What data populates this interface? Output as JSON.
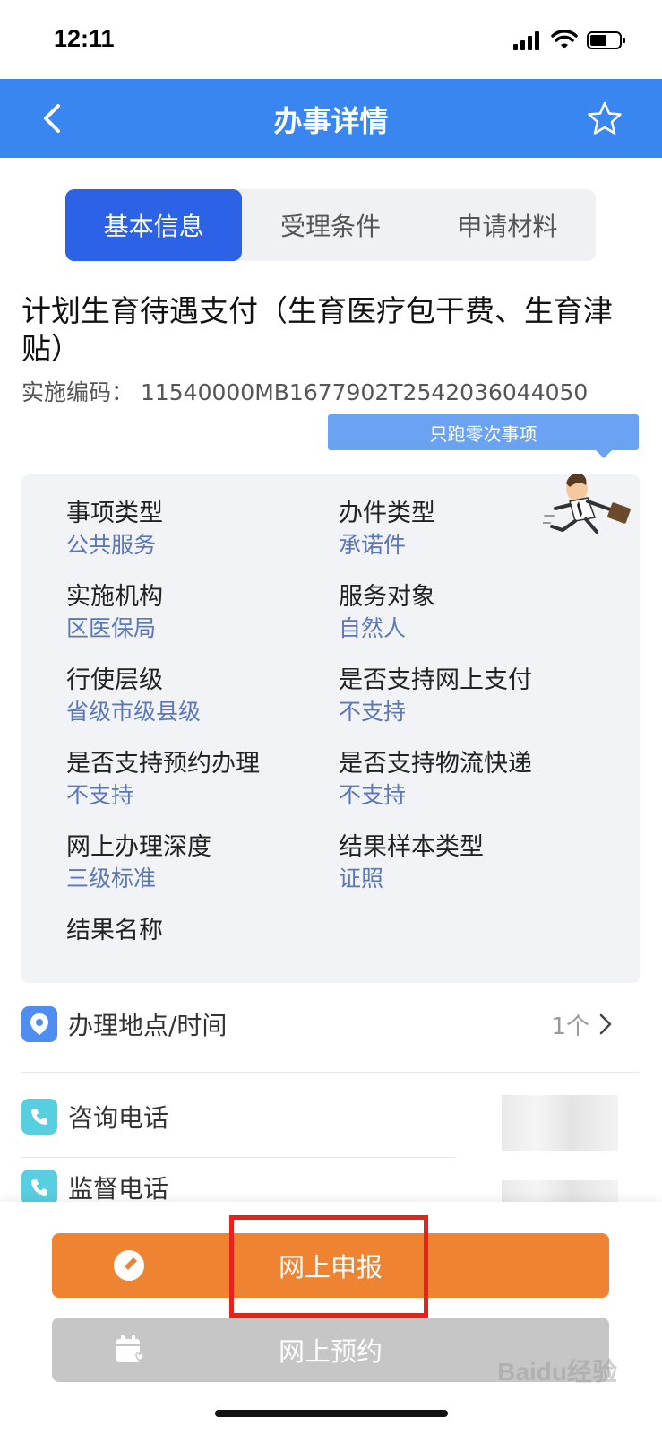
{
  "status": {
    "time": "12:11"
  },
  "nav": {
    "title": "办事详情"
  },
  "tabs": [
    {
      "label": "基本信息",
      "active": true
    },
    {
      "label": "受理条件",
      "active": false
    },
    {
      "label": "申请材料",
      "active": false
    }
  ],
  "item": {
    "title": "计划生育待遇支付（生育医疗包干费、生育津贴）",
    "code_label": "实施编码：",
    "code_value": "11540000MB1677902T2542036044050",
    "badge": "只跑零次事项"
  },
  "info": [
    {
      "label": "事项类型",
      "value": "公共服务"
    },
    {
      "label": "办件类型",
      "value": "承诺件"
    },
    {
      "label": "实施机构",
      "value": "区医保局"
    },
    {
      "label": "服务对象",
      "value": "自然人"
    },
    {
      "label": "行使层级",
      "value": "省级市级县级"
    },
    {
      "label": "是否支持网上支付",
      "value": "不支持"
    },
    {
      "label": "是否支持预约办理",
      "value": "不支持"
    },
    {
      "label": "是否支持物流快递",
      "value": "不支持"
    },
    {
      "label": "网上办理深度",
      "value": "三级标准"
    },
    {
      "label": "结果样本类型",
      "value": "证照"
    },
    {
      "label": "结果名称",
      "value": ""
    }
  ],
  "rows": {
    "location": {
      "label": "办理地点/时间",
      "count": "1个"
    },
    "consult": {
      "label": "咨询电话"
    },
    "supervise": {
      "label": "监督电话"
    }
  },
  "actions": {
    "apply": "网上申报",
    "reserve": "网上预约"
  },
  "watermark": "Baidu经验",
  "colors": {
    "nav": "#3a86f0",
    "tab_active": "#2c62e6",
    "value_text": "#5a77b8",
    "apply_button": "#ee8432",
    "reserve_button": "#c6c6c6",
    "highlight": "#e8211d"
  }
}
